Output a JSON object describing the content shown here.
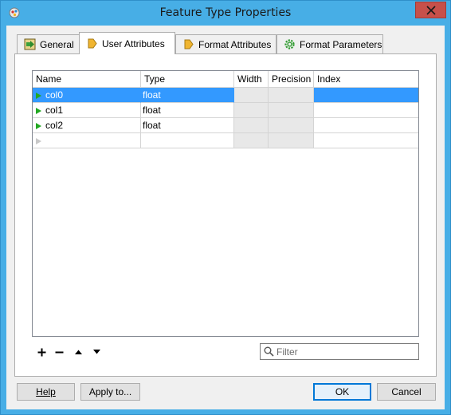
{
  "window": {
    "title": "Feature Type Properties",
    "close_label": "×"
  },
  "tabs": [
    {
      "label": "General",
      "icon": "general-icon",
      "active": false
    },
    {
      "label": "User Attributes",
      "icon": "user-attributes-icon",
      "active": true
    },
    {
      "label": "Format Attributes",
      "icon": "format-attributes-icon",
      "active": false
    },
    {
      "label": "Format Parameters",
      "icon": "gear-icon",
      "active": false
    }
  ],
  "grid": {
    "columns": [
      "Name",
      "Type",
      "Width",
      "Precision",
      "Index"
    ],
    "rows": [
      {
        "name": "col0",
        "type": "float",
        "width": "",
        "precision": "",
        "index": "",
        "selected": true
      },
      {
        "name": "col1",
        "type": "float",
        "width": "",
        "precision": "",
        "index": "",
        "selected": false
      },
      {
        "name": "col2",
        "type": "float",
        "width": "",
        "precision": "",
        "index": "",
        "selected": false
      }
    ]
  },
  "toolbar": {
    "add_icon": "plus-icon",
    "remove_icon": "minus-icon",
    "up_icon": "arrow-up-icon",
    "down_icon": "arrow-down-icon"
  },
  "filter": {
    "placeholder": "Filter",
    "value": ""
  },
  "buttons": {
    "help": "Help",
    "apply": "Apply to...",
    "ok": "OK",
    "cancel": "Cancel"
  },
  "colors": {
    "titlebar": "#47aee6",
    "selection": "#3399ff",
    "close": "#c7504a"
  }
}
